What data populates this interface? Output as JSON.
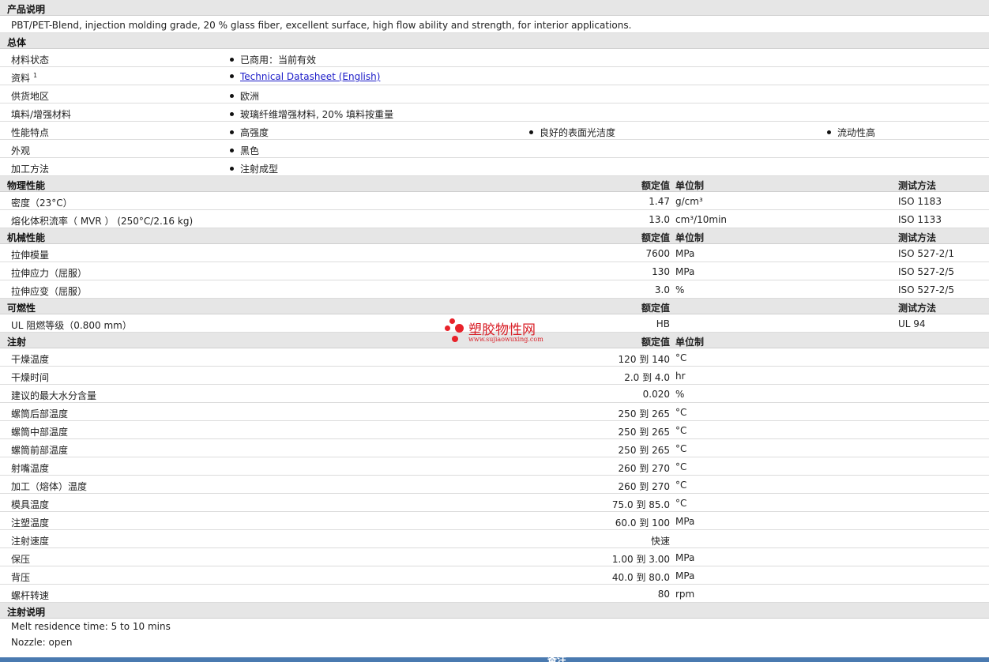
{
  "product_desc": {
    "heading": "产品说明",
    "text": "PBT/PET-Blend, injection molding grade, 20 % glass fiber, excellent surface, high flow ability and strength, for interior applications."
  },
  "general": {
    "heading": "总体",
    "rows": [
      {
        "label": "材料状态",
        "values": [
          "已商用：当前有效"
        ]
      },
      {
        "label": "资料",
        "sup": "1",
        "values": [
          "Technical Datasheet (English)"
        ],
        "link": true
      },
      {
        "label": "供货地区",
        "values": [
          "欧洲"
        ]
      },
      {
        "label": "填料/增强材料",
        "values": [
          "玻璃纤维增强材料, 20% 填料按重量"
        ]
      },
      {
        "label": "性能特点",
        "values": [
          "高强度",
          "良好的表面光洁度",
          "流动性高"
        ]
      },
      {
        "label": "外观",
        "values": [
          "黑色"
        ]
      },
      {
        "label": "加工方法",
        "values": [
          "注射成型"
        ]
      }
    ]
  },
  "physical": {
    "heading": "物理性能",
    "col_value": "额定值",
    "col_unit": "单位制",
    "col_test": "测试方法",
    "rows": [
      {
        "label": "密度（23°C）",
        "value": "1.47",
        "unit": "g/cm³",
        "test": "ISO 1183"
      },
      {
        "label": "熔化体积流率（ MVR ） (250°C/2.16 kg)",
        "value": "13.0",
        "unit": "cm³/10min",
        "test": "ISO 1133"
      }
    ]
  },
  "mechanical": {
    "heading": "机械性能",
    "col_value": "额定值",
    "col_unit": "单位制",
    "col_test": "测试方法",
    "rows": [
      {
        "label": "拉伸模量",
        "value": "7600",
        "unit": "MPa",
        "test": "ISO 527-2/1"
      },
      {
        "label": "拉伸应力（屈服）",
        "value": "130",
        "unit": "MPa",
        "test": "ISO 527-2/5"
      },
      {
        "label": "拉伸应变（屈服）",
        "value": "3.0",
        "unit": "%",
        "test": "ISO 527-2/5"
      }
    ]
  },
  "flammability": {
    "heading": "可燃性",
    "col_value": "额定值",
    "col_test": "测试方法",
    "rows": [
      {
        "label": "UL 阻燃等级（0.800 mm）",
        "value": "HB",
        "unit": "",
        "test": "UL 94"
      }
    ]
  },
  "injection": {
    "heading": "注射",
    "col_value": "额定值",
    "col_unit": "单位制",
    "rows": [
      {
        "label": "干燥温度",
        "value": "120 到  140",
        "unit": "°C"
      },
      {
        "label": "干燥时间",
        "value": "2.0 到  4.0",
        "unit": "hr"
      },
      {
        "label": "建议的最大水分含量",
        "value": "0.020",
        "unit": "%"
      },
      {
        "label": "螺筒后部温度",
        "value": "250 到  265",
        "unit": "°C"
      },
      {
        "label": "螺筒中部温度",
        "value": "250 到  265",
        "unit": "°C"
      },
      {
        "label": "螺筒前部温度",
        "value": "250 到  265",
        "unit": "°C"
      },
      {
        "label": "射嘴温度",
        "value": "260 到  270",
        "unit": "°C"
      },
      {
        "label": "加工（熔体）温度",
        "value": "260 到  270",
        "unit": "°C"
      },
      {
        "label": "模具温度",
        "value": "75.0 到  85.0",
        "unit": "°C"
      },
      {
        "label": "注塑温度",
        "value": "60.0 到  100",
        "unit": "MPa"
      },
      {
        "label": "注射速度",
        "value": "快速",
        "unit": ""
      },
      {
        "label": "保压",
        "value": "1.00 到  3.00",
        "unit": "MPa"
      },
      {
        "label": "背压",
        "value": "40.0 到  80.0",
        "unit": "MPa"
      },
      {
        "label": "螺杆转速",
        "value": "80",
        "unit": "rpm"
      }
    ]
  },
  "injection_notes": {
    "heading": "注射说明",
    "lines": [
      "Melt residence time: 5 to 10 mins",
      "Nozzle: open"
    ]
  },
  "footer": {
    "label": "备注"
  },
  "watermark": {
    "name": "塑胶物性网",
    "url": "www.sujiaowuxing.com"
  }
}
